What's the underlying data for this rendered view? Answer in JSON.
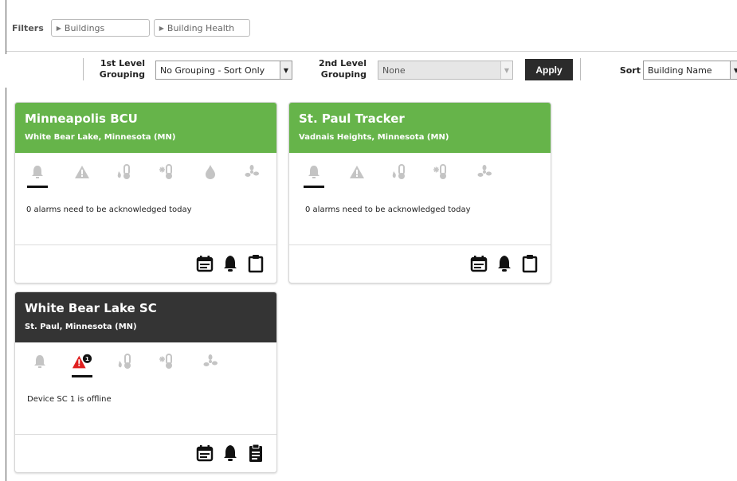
{
  "filters": {
    "label": "Filters",
    "buttons": [
      "Buildings",
      "Building Health"
    ]
  },
  "grouping": {
    "first_label_line1": "1st Level",
    "first_label_line2": "Grouping",
    "first_value": "No Grouping - Sort Only",
    "second_label_line1": "2nd Level",
    "second_label_line2": "Grouping",
    "second_value": "None",
    "apply_label": "Apply",
    "sort_label": "Sort",
    "sort_value": "Building Name"
  },
  "cards": [
    {
      "title": "Minneapolis BCU",
      "subtitle": "White Bear Lake, Minnesota (MN)",
      "status": "green",
      "icons": [
        "bell-icon",
        "warning-icon",
        "temperature-icon",
        "freeze-icon",
        "water-drop-icon",
        "fan-icon"
      ],
      "active_icon": "bell-icon",
      "message": "0 alarms need to be acknowledged today",
      "actions": [
        "schedule-icon",
        "alarm-bell-icon",
        "clipboard-icon"
      ]
    },
    {
      "title": "St. Paul Tracker",
      "subtitle": "Vadnais Heights, Minnesota (MN)",
      "status": "green",
      "icons": [
        "bell-icon",
        "warning-icon",
        "temperature-icon",
        "freeze-icon",
        "fan-icon"
      ],
      "active_icon": "bell-icon",
      "message": "0 alarms need to be acknowledged today",
      "actions": [
        "schedule-icon",
        "alarm-bell-icon",
        "clipboard-icon"
      ]
    },
    {
      "title": "White Bear Lake SC",
      "subtitle": "St. Paul, Minnesota (MN)",
      "status": "dark",
      "icons": [
        "bell-icon",
        "warning-icon",
        "temperature-icon",
        "freeze-icon",
        "fan-icon"
      ],
      "active_icon": "warning-icon",
      "warning_badge": "1",
      "message": "Device SC 1 is offline",
      "actions": [
        "schedule-icon",
        "alarm-bell-icon",
        "clipboard-list-icon"
      ]
    }
  ],
  "colors": {
    "status_green": "#66b44a",
    "status_dark": "#343434",
    "alert_red": "#e02020",
    "icon_gray": "#c4c4c4"
  }
}
